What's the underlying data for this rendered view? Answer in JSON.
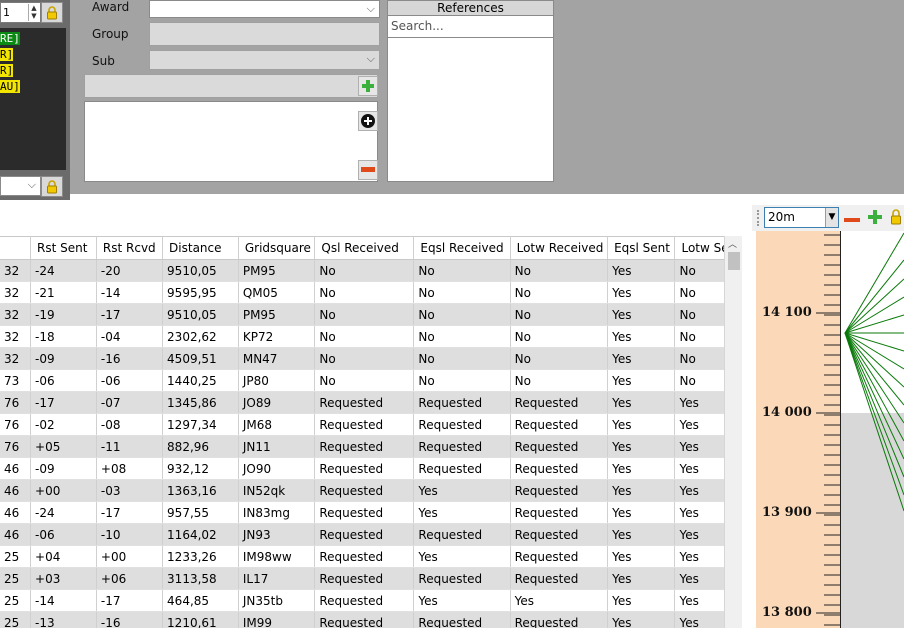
{
  "left_panel": {
    "spin_value": "1",
    "tags": [
      {
        "text": "RE]",
        "bg": "#0a8a12",
        "fg": "#ffffff"
      },
      {
        "text": "R]",
        "bg": "#f2e600",
        "fg": "#000000"
      },
      {
        "text": "R]",
        "bg": "#f2e600",
        "fg": "#000000"
      },
      {
        "text": "AU]",
        "bg": "#f2e600",
        "fg": "#000000"
      }
    ]
  },
  "award_form": {
    "award_label": "Award",
    "group_label": "Group",
    "sub_label": "Sub"
  },
  "references": {
    "title": "References",
    "search_placeholder": "Search..."
  },
  "table": {
    "columns": [
      "",
      "Rst Sent",
      "Rst Rcvd",
      "Distance",
      "Gridsquare",
      "Qsl Received",
      "Eqsl Received",
      "Lotw Received",
      "Eqsl Sent",
      "Lotw Sent"
    ],
    "rows": [
      [
        "32",
        "-24",
        "-20",
        "9510,05",
        "PM95",
        "No",
        "No",
        "No",
        "Yes",
        "No"
      ],
      [
        "32",
        "-21",
        "-14",
        "9595,95",
        "QM05",
        "No",
        "No",
        "No",
        "Yes",
        "No"
      ],
      [
        "32",
        "-19",
        "-17",
        "9510,05",
        "PM95",
        "No",
        "No",
        "No",
        "Yes",
        "No"
      ],
      [
        "32",
        "-18",
        "-04",
        "2302,62",
        "KP72",
        "No",
        "No",
        "No",
        "Yes",
        "No"
      ],
      [
        "32",
        "-09",
        "-16",
        "4509,51",
        "MN47",
        "No",
        "No",
        "No",
        "Yes",
        "No"
      ],
      [
        "73",
        "-06",
        "-06",
        "1440,25",
        "JP80",
        "No",
        "No",
        "No",
        "Yes",
        "No"
      ],
      [
        "76",
        "-17",
        "-07",
        "1345,86",
        "JO89",
        "Requested",
        "Requested",
        "Requested",
        "Yes",
        "Yes"
      ],
      [
        "76",
        "-02",
        "-08",
        "1297,34",
        "JM68",
        "Requested",
        "Requested",
        "Requested",
        "Yes",
        "Yes"
      ],
      [
        "76",
        "+05",
        "-11",
        "882,96",
        "JN11",
        "Requested",
        "Requested",
        "Requested",
        "Yes",
        "Yes"
      ],
      [
        "46",
        "-09",
        "+08",
        "932,12",
        "JO90",
        "Requested",
        "Requested",
        "Requested",
        "Yes",
        "Yes"
      ],
      [
        "46",
        "+00",
        "-03",
        "1363,16",
        "IN52qk",
        "Requested",
        "Yes",
        "Requested",
        "Yes",
        "Yes"
      ],
      [
        "46",
        "-24",
        "-17",
        "957,55",
        "IN83mg",
        "Requested",
        "Yes",
        "Requested",
        "Yes",
        "Yes"
      ],
      [
        "46",
        "-06",
        "-10",
        "1164,02",
        "JN93",
        "Requested",
        "Requested",
        "Requested",
        "Yes",
        "Yes"
      ],
      [
        "25",
        "+04",
        "+00",
        "1233,26",
        "IM98ww",
        "Requested",
        "Yes",
        "Requested",
        "Yes",
        "Yes"
      ],
      [
        "25",
        "+03",
        "+06",
        "3113,58",
        "IL17",
        "Requested",
        "Requested",
        "Requested",
        "Yes",
        "Yes"
      ],
      [
        "25",
        "-14",
        "-17",
        "464,85",
        "JN35tb",
        "Requested",
        "Yes",
        "Yes",
        "Yes",
        "Yes"
      ],
      [
        "25",
        "-13",
        "-16",
        "1210,61",
        "IM99",
        "Requested",
        "Requested",
        "Requested",
        "Yes",
        "Yes"
      ]
    ]
  },
  "band": {
    "selected": "20m",
    "freq_labels": [
      "14 100",
      "14 000",
      "13 900",
      "13 800"
    ]
  },
  "colors": {
    "panel_gray": "#a3a3a3",
    "scale_bg": "#fad8b8",
    "map_line": "#0a7a0a",
    "accent_blue": "#3c7fb1"
  }
}
